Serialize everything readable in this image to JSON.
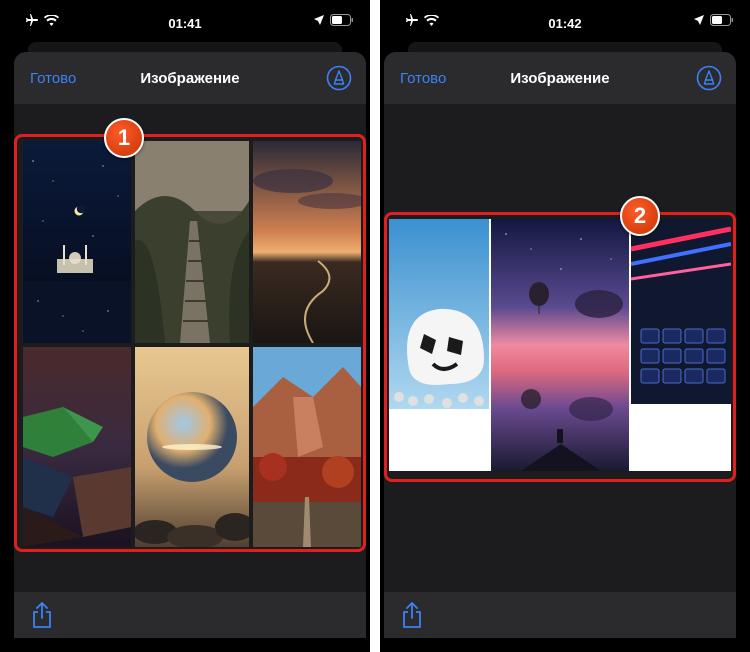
{
  "left": {
    "status": {
      "time": "01:41"
    },
    "navbar": {
      "done_label": "Готово",
      "title": "Изображение",
      "markup_icon": "markup-pen-icon"
    },
    "toolbar": {
      "share_icon": "share-icon"
    },
    "badge": "1",
    "images": [
      "night-mosque-crescent-moon",
      "forest-stairs-path",
      "sunset-winding-road",
      "low-poly-aurora",
      "crystal-ball-beach",
      "autumn-canyon-boardwalk"
    ]
  },
  "right": {
    "status": {
      "time": "01:42"
    },
    "navbar": {
      "done_label": "Готово",
      "title": "Изображение",
      "markup_icon": "markup-pen-icon"
    },
    "toolbar": {
      "share_icon": "share-icon"
    },
    "badge": "2",
    "images": [
      "marshmello-helmet-sky",
      "hot-air-balloons-lake-sunset",
      "neon-fire-keyboard"
    ]
  },
  "colors": {
    "accent": "#3b82f6",
    "highlight": "#e02020",
    "badge": "#e8491d"
  }
}
